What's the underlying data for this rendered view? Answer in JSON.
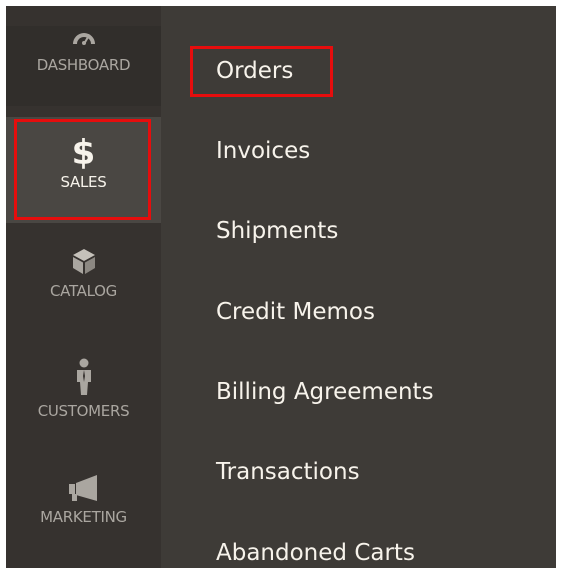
{
  "sidebar": {
    "items": [
      {
        "label": "DASHBOARD",
        "icon": "dashboard-gauge-icon"
      },
      {
        "label": "$",
        "icon": "dollar-icon"
      },
      {
        "label": "SALES"
      },
      {
        "label": "CATALOG",
        "icon": "box-icon"
      },
      {
        "label": "CUSTOMERS",
        "icon": "person-icon"
      },
      {
        "label": "MARKETING",
        "icon": "megaphone-icon"
      }
    ]
  },
  "submenu": {
    "items": [
      {
        "label": "Orders"
      },
      {
        "label": "Invoices"
      },
      {
        "label": "Shipments"
      },
      {
        "label": "Credit Memos"
      },
      {
        "label": "Billing Agreements"
      },
      {
        "label": "Transactions"
      },
      {
        "label": "Abandoned Carts"
      }
    ]
  },
  "colors": {
    "highlight": "#e60d0d",
    "sidebar_bg": "#36322f",
    "submenu_bg": "#3e3b37",
    "active_item_bg": "#4a4743",
    "text_light": "#f7f3eb",
    "text_muted": "#aaa6a0"
  }
}
